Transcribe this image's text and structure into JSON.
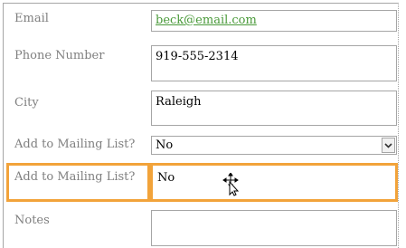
{
  "form": {
    "fields": [
      {
        "label": "Email",
        "value": "beck@email.com"
      },
      {
        "label": "Phone Number",
        "value": "919-555-2314"
      },
      {
        "label": "City",
        "value": "Raleigh"
      },
      {
        "label": "Add to Mailing List?",
        "value": "No"
      },
      {
        "label": "Add to Mailing List?",
        "value": "No"
      },
      {
        "label": "Notes",
        "value": ""
      }
    ]
  },
  "icons": {
    "dropdown": "chevron-down-icon",
    "cursor": "move-cursor-icon"
  },
  "colors": {
    "selection": "#f2a33a",
    "link": "#4a9a3a",
    "label": "#7f7f7f",
    "border": "#a6a6a6"
  }
}
